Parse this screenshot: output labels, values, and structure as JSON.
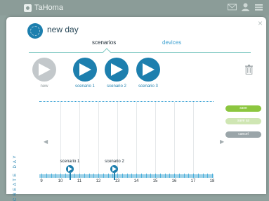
{
  "app": {
    "name": "TaHoma"
  },
  "modal": {
    "title": "new day",
    "close_label": "×",
    "tabs": [
      {
        "label": "scenarios",
        "active": true
      },
      {
        "label": "devices",
        "active": false
      }
    ],
    "scenarios": [
      {
        "label": "new",
        "state": "disabled"
      },
      {
        "label": "scenario 1"
      },
      {
        "label": "scenario 2"
      },
      {
        "label": "scenario 3"
      }
    ],
    "timeline": {
      "hours": [
        "9",
        "10",
        "11",
        "12",
        "13",
        "14",
        "15",
        "16",
        "17",
        "18"
      ],
      "markers": [
        {
          "label": "scenario 1",
          "time": 10.5
        },
        {
          "label": "scenario 2",
          "time": 12.85
        }
      ]
    },
    "side_label": "CREATE DAY",
    "actions": {
      "save": "save",
      "save_as": "save as",
      "cancel": "cancel"
    }
  },
  "colors": {
    "accent": "#1d7fae",
    "save_green": "#8cc63f",
    "disabled_green": "#cfe6b3",
    "cancel_gray": "#9aa5a9",
    "backdrop": "#8fa19d"
  },
  "icons": [
    "tahoma-logo-icon",
    "mail-icon",
    "user-icon",
    "menu-icon",
    "close-icon",
    "play-icon",
    "trash-icon",
    "chevron-left-icon",
    "chevron-right-icon"
  ]
}
